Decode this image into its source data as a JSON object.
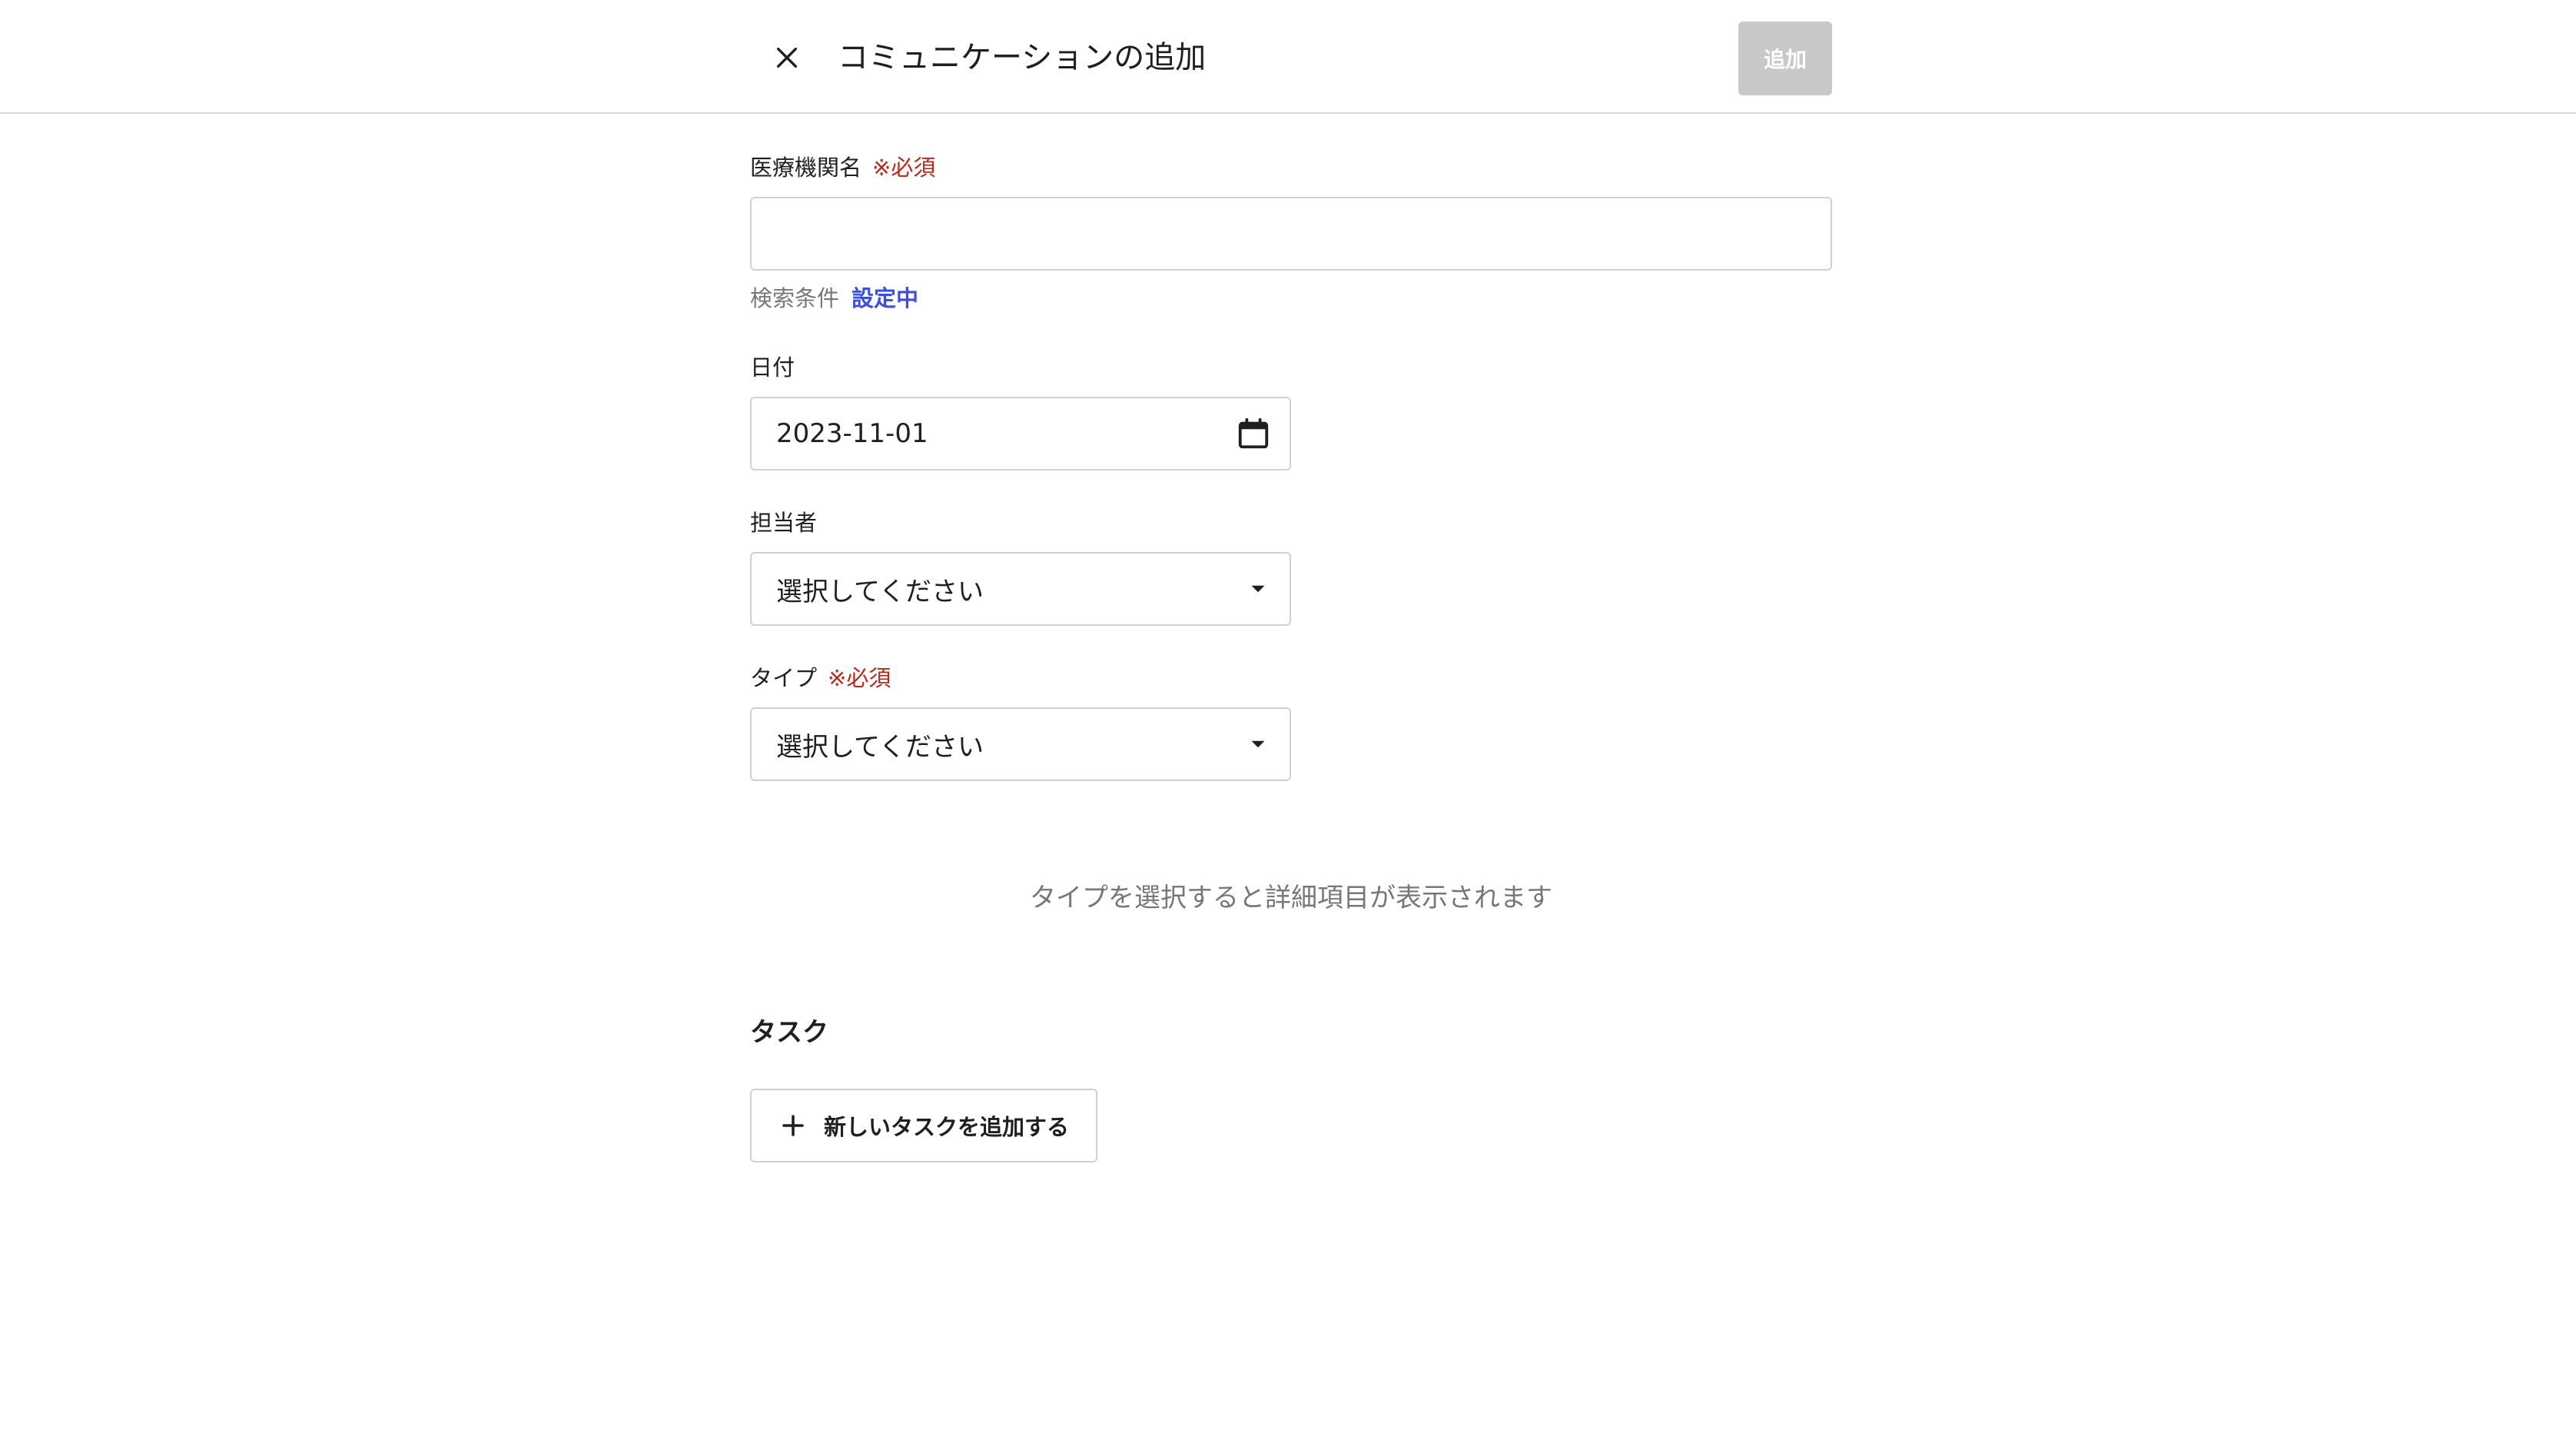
{
  "header": {
    "title": "コミュニケーションの追加",
    "submit_label": "追加",
    "close_icon": "close-icon"
  },
  "form": {
    "facility": {
      "label": "医療機関名",
      "required": "※必須",
      "value": ""
    },
    "search": {
      "label": "検索条件",
      "status": "設定中"
    },
    "date": {
      "label": "日付",
      "value": "2023-11-01",
      "icon": "calendar-icon"
    },
    "assignee": {
      "label": "担当者",
      "value": "選択してください",
      "icon": "caret-down-icon"
    },
    "type": {
      "label": "タイプ",
      "required": "※必須",
      "value": "選択してください",
      "icon": "caret-down-icon"
    },
    "hint": "タイプを選択すると詳細項目が表示されます"
  },
  "tasks": {
    "title": "タスク",
    "add_label": "新しいタスクを追加する",
    "add_icon": "plus-icon"
  },
  "colors": {
    "required": "#b32d1e",
    "link": "#3b4fd8",
    "disabled_button": "#c8c8c8",
    "muted_text": "#777777",
    "border": "#d0d0d0"
  }
}
